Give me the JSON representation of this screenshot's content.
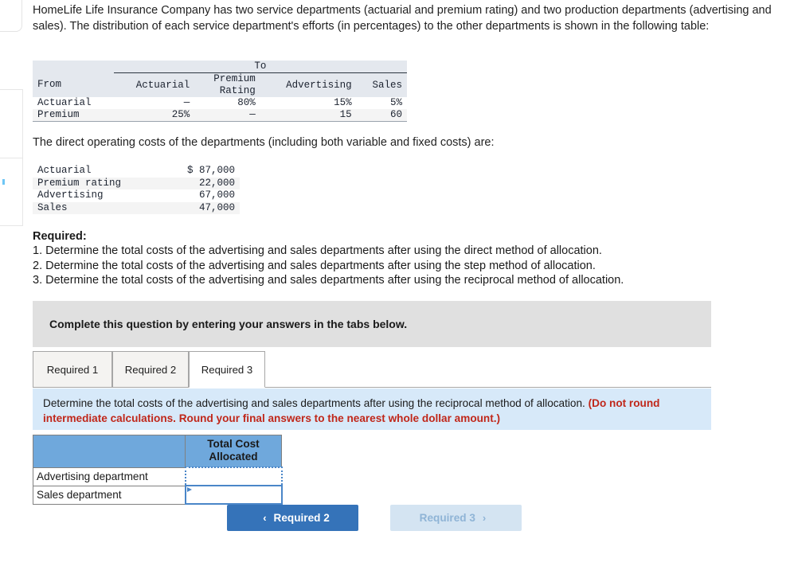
{
  "intro": {
    "text": "HomeLife Life Insurance Company has two service departments (actuarial and premium rating) and two production departments (advertising and sales). The distribution of each service department's efforts (in percentages) to the other departments is shown in the following table:"
  },
  "distribution_table": {
    "group_header": "To",
    "columns": [
      "From",
      "Actuarial",
      "Premium Rating",
      "Advertising",
      "Sales"
    ],
    "column_parts": {
      "premium_rating_line1": "Premium",
      "premium_rating_line2": "Rating"
    },
    "rows": [
      {
        "from": "Actuarial",
        "actuarial": "—",
        "premium_rating": "80%",
        "advertising": "15%",
        "sales": "5%"
      },
      {
        "from": "Premium",
        "actuarial": "25%",
        "premium_rating": "—",
        "advertising": "15",
        "sales": "60"
      }
    ]
  },
  "costs_intro": {
    "text": "The direct operating costs of the departments (including both variable and fixed costs) are:"
  },
  "costs_table": {
    "rows": [
      {
        "label": "Actuarial",
        "amount": "$ 87,000"
      },
      {
        "label": "Premium rating",
        "amount": "22,000"
      },
      {
        "label": "Advertising",
        "amount": "67,000"
      },
      {
        "label": "Sales",
        "amount": "47,000"
      }
    ]
  },
  "required": {
    "heading": "Required:",
    "items": [
      "1. Determine the total costs of the advertising and sales departments after using the direct method of allocation.",
      "2. Determine the total costs of the advertising and sales departments after using the step method of allocation.",
      "3. Determine the total costs of the advertising and sales departments after using the reciprocal method of allocation."
    ]
  },
  "banner": {
    "text": "Complete this question by entering your answers in the tabs below."
  },
  "tabs": [
    {
      "label": "Required 1",
      "active": false
    },
    {
      "label": "Required 2",
      "active": false
    },
    {
      "label": "Required 3",
      "active": true
    }
  ],
  "info_panel": {
    "main_text": "Determine the total costs of the advertising and sales departments after using the reciprocal method of allocation. ",
    "red_text": "(Do not round intermediate calculations. Round your final answers to the nearest whole dollar amount.)"
  },
  "answer_table": {
    "header_blank": "",
    "header_total_line1": "Total Cost",
    "header_total_line2": "Allocated",
    "rows": [
      {
        "label": "Advertising department",
        "value": ""
      },
      {
        "label": "Sales department",
        "value": ""
      }
    ]
  },
  "nav": {
    "prev_label": "Required 2",
    "prev_chevron": "‹",
    "next_label": "Required 3",
    "next_chevron": "›"
  },
  "colors": {
    "accent_blue": "#3573b9",
    "panel_blue": "#d7e9f9",
    "header_blue": "#6fa8dc",
    "banner_gray": "#e0e0e0",
    "red_text": "#c0271a"
  }
}
